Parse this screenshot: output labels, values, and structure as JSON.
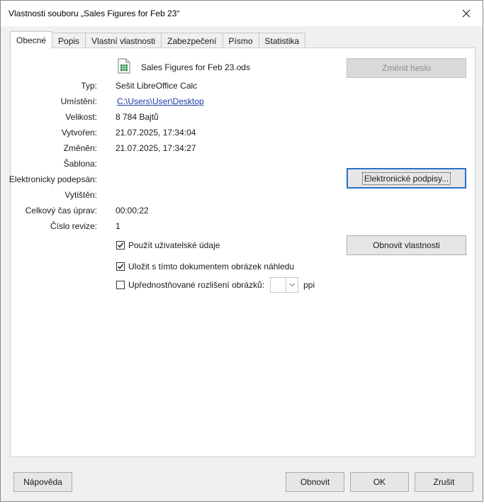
{
  "window": {
    "title": "Vlastnosti souboru „Sales Figures for Feb 23“"
  },
  "tabs": [
    {
      "label": "Obecné",
      "active": true
    },
    {
      "label": "Popis"
    },
    {
      "label": "Vlastní vlastnosti"
    },
    {
      "label": "Zabezpečení"
    },
    {
      "label": "Písmo"
    },
    {
      "label": "Statistika"
    }
  ],
  "general": {
    "filename": "Sales Figures for Feb 23.ods",
    "change_password_label": "Změnit heslo",
    "fields": [
      {
        "label": "Typ:",
        "value": "Sešit LibreOffice Calc"
      },
      {
        "label": "Umístění:",
        "value": "C:\\Users\\User\\Desktop"
      },
      {
        "label": "Velikost:",
        "value": "8 784 Bajtů"
      },
      {
        "label": "Vytvořen:",
        "value": "21.07.2025, 17:34:04"
      },
      {
        "label": "Změněn:",
        "value": "21.07.2025, 17:34:27"
      },
      {
        "label": "Šablona:",
        "value": ""
      },
      {
        "label": "Elektronicky podepsán:",
        "value": ""
      },
      {
        "label": "Vytištěn:",
        "value": ""
      },
      {
        "label": "Celkový čas úprav:",
        "value": "00:00:22"
      },
      {
        "label": "Číslo revize:",
        "value": "1"
      }
    ],
    "signatures_button": "Elektronické podpisy...",
    "reset_button": "Obnovit vlastnosti",
    "checkboxes": [
      {
        "label": "Použít uživatelské údaje",
        "checked": true
      },
      {
        "label": "Uložit s tímto dokumentem obrázek náhledu",
        "checked": true
      },
      {
        "label": "Upřednostňované rozlišení obrázků:",
        "checked": false
      }
    ],
    "resolution_unit": "ppi"
  },
  "footer": {
    "help": "Nápověda",
    "reset": "Obnovit",
    "ok": "OK",
    "cancel": "Zrušit"
  },
  "colors": {
    "accent": "#2a6fcf",
    "link": "#1a3fa8",
    "spreadsheet_icon": "#1e8a3c"
  }
}
